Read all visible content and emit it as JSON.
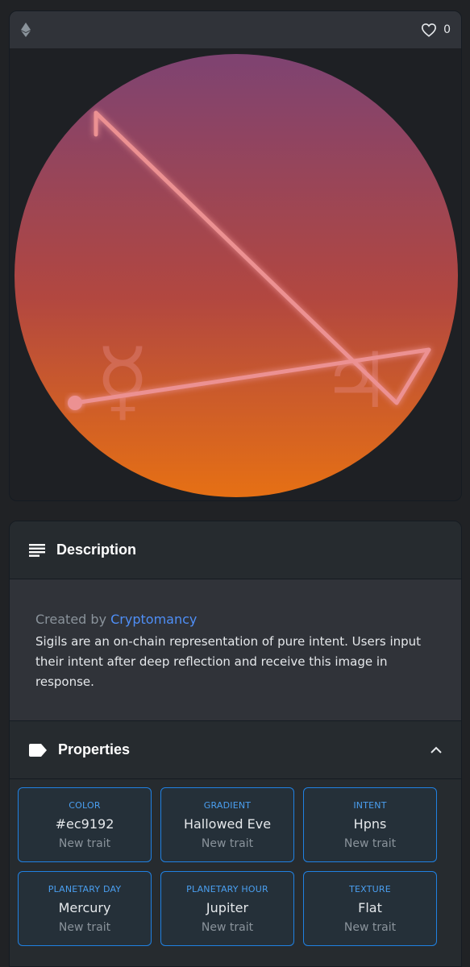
{
  "header": {
    "chain_icon": "ethereum-icon",
    "favorite_icon": "heart-outline-icon",
    "favorite_count": "0"
  },
  "artwork": {
    "gradient_colors": [
      "#7e4372",
      "#b24740",
      "#e67014"
    ],
    "line_color": "#ec9192",
    "glyphs": [
      "☿",
      "♃"
    ]
  },
  "description": {
    "title": "Description",
    "icon": "list-lines-icon",
    "created_by_label": "Created by",
    "creator": "Cryptomancy",
    "text": "Sigils are an on-chain representation of pure intent. Users input their intent after deep reflection and receive this image in response."
  },
  "properties": {
    "title": "Properties",
    "icon": "tag-icon",
    "toggle_icon": "chevron-up-icon",
    "traits": [
      {
        "type": "COLOR",
        "value": "#ec9192",
        "rarity": "New trait"
      },
      {
        "type": "GRADIENT",
        "value": "Hallowed Eve",
        "rarity": "New trait"
      },
      {
        "type": "INTENT",
        "value": "Hpns",
        "rarity": "New trait"
      },
      {
        "type": "PLANETARY DAY",
        "value": "Mercury",
        "rarity": "New trait"
      },
      {
        "type": "PLANETARY HOUR",
        "value": "Jupiter",
        "rarity": "New trait"
      },
      {
        "type": "TEXTURE",
        "value": "Flat",
        "rarity": "New trait"
      }
    ]
  }
}
